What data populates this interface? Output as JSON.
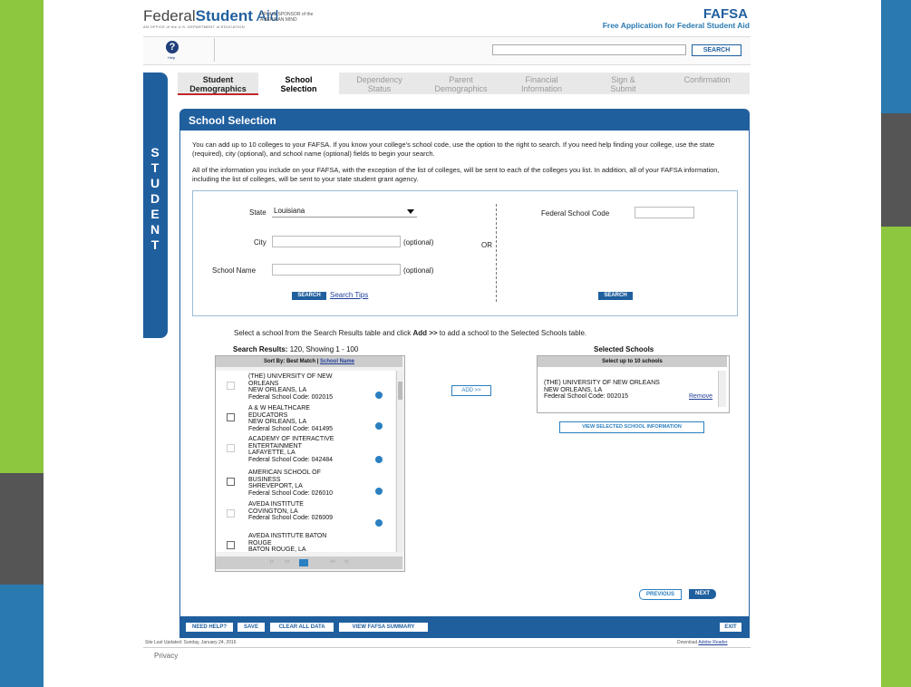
{
  "brand": {
    "logo_regular": "Federal",
    "logo_bold": "Student",
    "logo_aid": "Aid",
    "logo_sub": "AN OFFICE of the U.S. DEPARTMENT of EDUCATION",
    "sponsor": "PROUD SPONSOR of the AMERICAN MIND",
    "fafsa": "FAFSA",
    "fafsa_sub": "Free Application for Federal Student Aid"
  },
  "help": {
    "label": "Help"
  },
  "search": {
    "button": "SEARCH",
    "value": ""
  },
  "tabs": [
    {
      "line1": "Student",
      "line2": "Demographics",
      "state": "done"
    },
    {
      "line1": "School",
      "line2": "Selection",
      "state": "active"
    },
    {
      "line1": "Dependency",
      "line2": "Status",
      "state": "future"
    },
    {
      "line1": "Parent",
      "line2": "Demographics",
      "state": "future"
    },
    {
      "line1": "Financial",
      "line2": "Information",
      "state": "future"
    },
    {
      "line1": "Sign &",
      "line2": "Submit",
      "state": "future"
    },
    {
      "line1": "Confirmation",
      "line2": "",
      "state": "future"
    }
  ],
  "side_label": [
    "S",
    "T",
    "U",
    "D",
    "E",
    "N",
    "T"
  ],
  "section": {
    "title": "School Selection",
    "para1": "You can add up to 10 colleges to your FAFSA. If you know your college's school code, use the option to the right to search. If you need help finding your college, use the state (required), city (optional), and school name (optional) fields to begin your search.",
    "para2": "All of the information you include on your FAFSA, with the exception of the list of colleges, will be sent to each of the colleges you list. In addition, all of your FAFSA information, including the list of colleges, will be sent to your state student grant agency."
  },
  "form": {
    "state_label": "State",
    "state_value": "Louisiana",
    "city_label": "City",
    "city_value": "",
    "optional": "(optional)",
    "school_name_label": "School Name",
    "school_name_value": "",
    "or_label": "OR",
    "code_label": "Federal School Code",
    "code_value": "",
    "search_button": "SEARCH",
    "search_tips": "Search Tips",
    "code_search_button": "SEARCH"
  },
  "instruction_pre": "Select a school from the Search Results table and click ",
  "instruction_bold": "Add >>",
  "instruction_post": " to add a school to the Selected Schools table.",
  "results": {
    "title": "Search Results: ",
    "summary": "120, Showing 1 - 100",
    "sort_label": "Sort By:  Best Match | ",
    "sort_link": "School Name",
    "items": [
      {
        "name1": "(THE) UNIVERSITY OF NEW",
        "name2": "ORLEANS",
        "name3": "",
        "loc": "NEW ORLEANS, LA",
        "code": "Federal School Code: 002015"
      },
      {
        "name1": "A & W HEALTHCARE",
        "name2": "EDUCATORS",
        "name3": "",
        "loc": "NEW ORLEANS, LA",
        "code": "Federal School Code: 041495"
      },
      {
        "name1": "ACADEMY OF INTERACTIVE",
        "name2": "ENTERTAINMENT",
        "name3": "",
        "loc": "LAFAYETTE, LA",
        "code": "Federal School Code: 042484"
      },
      {
        "name1": "AMERICAN SCHOOL OF",
        "name2": "BUSINESS",
        "name3": "",
        "loc": "SHREVEPORT, LA",
        "code": "Federal School Code: 026010"
      },
      {
        "name1": "AVEDA INSTITUTE",
        "name2": "",
        "name3": "",
        "loc": "COVINGTON, LA",
        "code": "Federal School Code: 026009"
      },
      {
        "name1": "AVEDA INSTITUTE BATON",
        "name2": "ROUGE",
        "name3": "",
        "loc": "BATON ROUGE, LA",
        "code": ""
      }
    ]
  },
  "add_button": "ADD >>",
  "selected": {
    "title": "Selected Schools",
    "header": "Select up to 10 schools",
    "item_name1": "(THE) UNIVERSITY OF NEW ORLEANS",
    "item_loc": "NEW ORLEANS, LA",
    "item_code": "Federal School Code: 002015",
    "remove": "Remove",
    "view_button": "VIEW SELECTED SCHOOL INFORMATION"
  },
  "nav": {
    "previous": "PREVIOUS",
    "next": "NEXT"
  },
  "footer_buttons": [
    "NEED HELP?",
    "SAVE",
    "CLEAR ALL DATA",
    "VIEW FAFSA SUMMARY"
  ],
  "exit": "EXIT",
  "last_updated": "Site Last Updated: Sunday, January 24, 2016",
  "download": "Download",
  "download_link": "Adobe Reader",
  "privacy": "Privacy",
  "colors": {
    "blue": "#1f5f9e",
    "green": "#8dc63f",
    "slide_blue": "#2a7ab0",
    "slide_gray": "#555555"
  }
}
